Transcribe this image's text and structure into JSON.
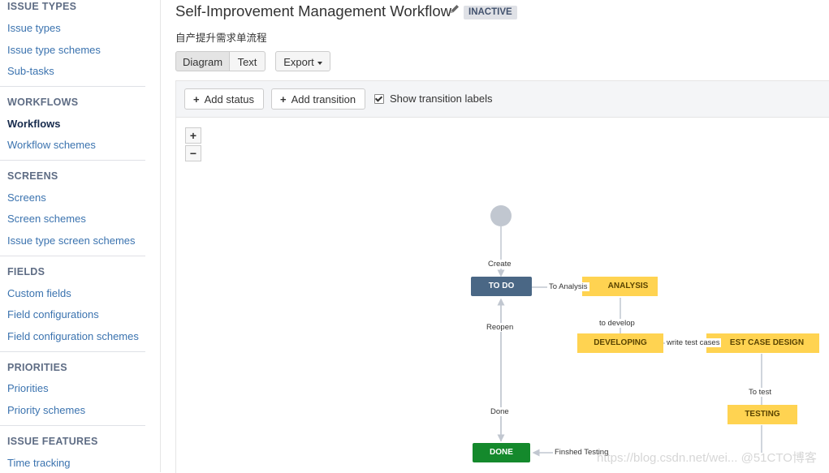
{
  "sidebar": {
    "sections": [
      {
        "title": "ISSUE TYPES",
        "links": [
          "Issue types",
          "Issue type schemes",
          "Sub-tasks"
        ]
      },
      {
        "title": "WORKFLOWS",
        "links": [
          "Workflows",
          "Workflow schemes"
        ],
        "active": "Workflows"
      },
      {
        "title": "SCREENS",
        "links": [
          "Screens",
          "Screen schemes",
          "Issue type screen schemes"
        ]
      },
      {
        "title": "FIELDS",
        "links": [
          "Custom fields",
          "Field configurations",
          "Field configuration schemes"
        ]
      },
      {
        "title": "PRIORITIES",
        "links": [
          "Priorities",
          "Priority schemes"
        ]
      },
      {
        "title": "ISSUE FEATURES",
        "links": [
          "Time tracking"
        ]
      }
    ]
  },
  "header": {
    "title": "Self-Improvement Management Workflow",
    "status_badge": "INACTIVE",
    "description": "自产提升需求单流程",
    "view_tabs": [
      "Diagram",
      "Text"
    ],
    "export_label": "Export"
  },
  "toolbar": {
    "add_status": "Add status",
    "add_transition": "Add transition",
    "show_labels": "Show transition labels",
    "show_labels_checked": true
  },
  "zoom": {
    "in": "+",
    "out": "−"
  },
  "diagram": {
    "statuses": {
      "todo": "TO DO",
      "analysis": "ANALYSIS",
      "developing": "DEVELOPING",
      "test_case_design": "EST CASE DESIGN",
      "testing": "TESTING",
      "done": "DONE"
    },
    "transitions": {
      "create": "Create",
      "to_analysis": "To Analysis",
      "to_develop": "to develop",
      "write_test_cases": "write test cases",
      "to_test": "To test",
      "reopen": "Reopen",
      "done": "Done",
      "finished_testing": "Finshed Testing"
    },
    "colors": {
      "todo": "#4a6785",
      "done": "#14892c",
      "inprogress": "#ffd351",
      "initial": "#c1c7d0"
    }
  },
  "watermark": "https://blog.csdn.net/wei... @51CTO博客"
}
